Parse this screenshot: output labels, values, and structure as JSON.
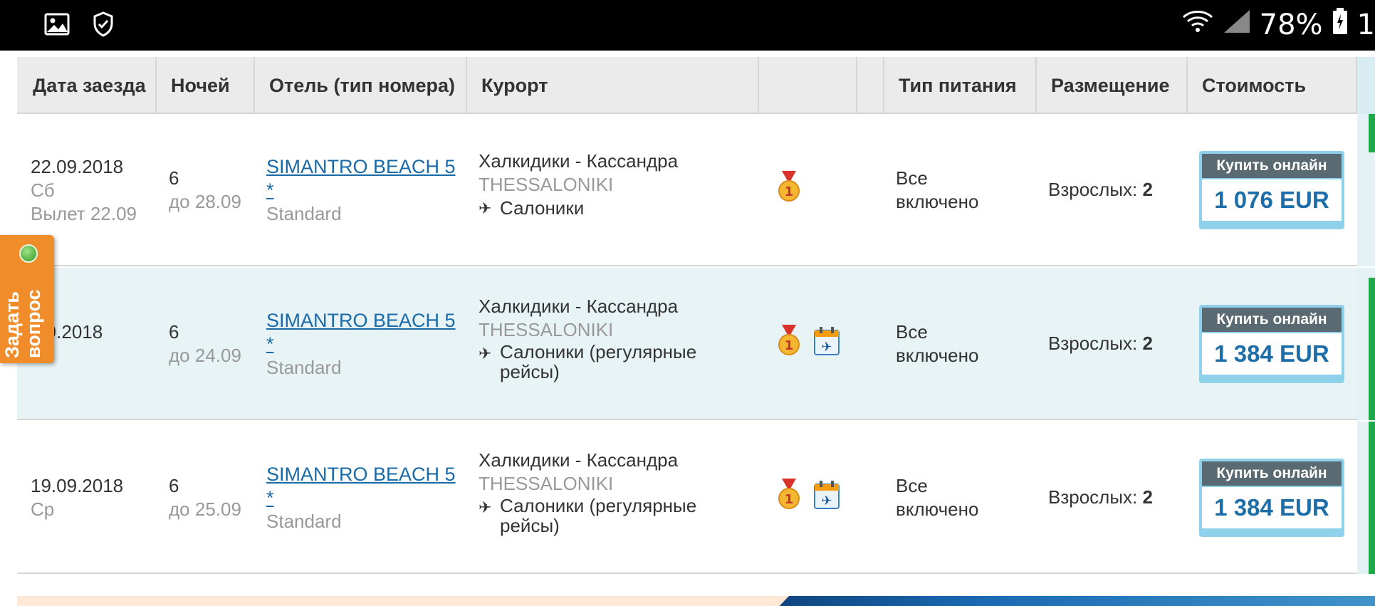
{
  "status_bar": {
    "battery": "78%",
    "time_partial": "1",
    "icons": [
      "image-icon",
      "shield-check-icon",
      "wifi-icon",
      "signal-icon",
      "battery-icon"
    ]
  },
  "table": {
    "headers": {
      "date": "Дата заезда",
      "nights": "Ночей",
      "hotel": "Отель (тип номера)",
      "resort": "Курорт",
      "extra1": "",
      "extra2": "",
      "meal": "Тип питания",
      "placement": "Размещение",
      "price": "Стоимость"
    },
    "rows": [
      {
        "date": "22.09.2018",
        "weekday": "Сб",
        "departure": "Вылет 22.09",
        "nights": "6",
        "until": "до 28.09",
        "hotel_line1": "SIMANTRO BEACH 5",
        "hotel_line2": "*",
        "room": "Standard",
        "resort": "Халкидики - Кассандра",
        "region": "THESSALONIKI",
        "flight": "Салоники",
        "flight_line2": "",
        "meal_line1": "Все",
        "meal_line2": "включено",
        "placement_label": "Взрослых:",
        "placement_value": "2",
        "buy_label": "Купить онлайн",
        "price": "1 076 EUR"
      },
      {
        "date": ".09.2018",
        "weekday": "",
        "departure": "",
        "nights": "6",
        "until": "до 24.09",
        "hotel_line1": "SIMANTRO BEACH 5",
        "hotel_line2": "*",
        "room": "Standard",
        "resort": "Халкидики - Кассандра",
        "region": "THESSALONIKI",
        "flight": "Салоники (регулярные",
        "flight_line2": "рейсы)",
        "meal_line1": "Все",
        "meal_line2": "включено",
        "placement_label": "Взрослых:",
        "placement_value": "2",
        "buy_label": "Купить онлайн",
        "price": "1 384 EUR"
      },
      {
        "date": "19.09.2018",
        "weekday": "Ср",
        "departure": "",
        "nights": "6",
        "until": "до 25.09",
        "hotel_line1": "SIMANTRO BEACH 5",
        "hotel_line2": "*",
        "room": "Standard",
        "resort": "Халкидики - Кассандра",
        "region": "THESSALONIKI",
        "flight": "Салоники (регулярные",
        "flight_line2": "рейсы)",
        "meal_line1": "Все",
        "meal_line2": "включено",
        "placement_label": "Взрослых:",
        "placement_value": "2",
        "buy_label": "Купить онлайн",
        "price": "1 384 EUR"
      }
    ]
  },
  "ask_question": {
    "label_line1": "Задать",
    "label_line2": "вопрос"
  },
  "colors": {
    "link": "#1a6aa8",
    "price": "#1d6ea8",
    "buy_header": "#5a6a72",
    "buy_border": "#8fd0ea",
    "ask_tab": "#f08c2a",
    "status_green": "#1fa84a"
  }
}
